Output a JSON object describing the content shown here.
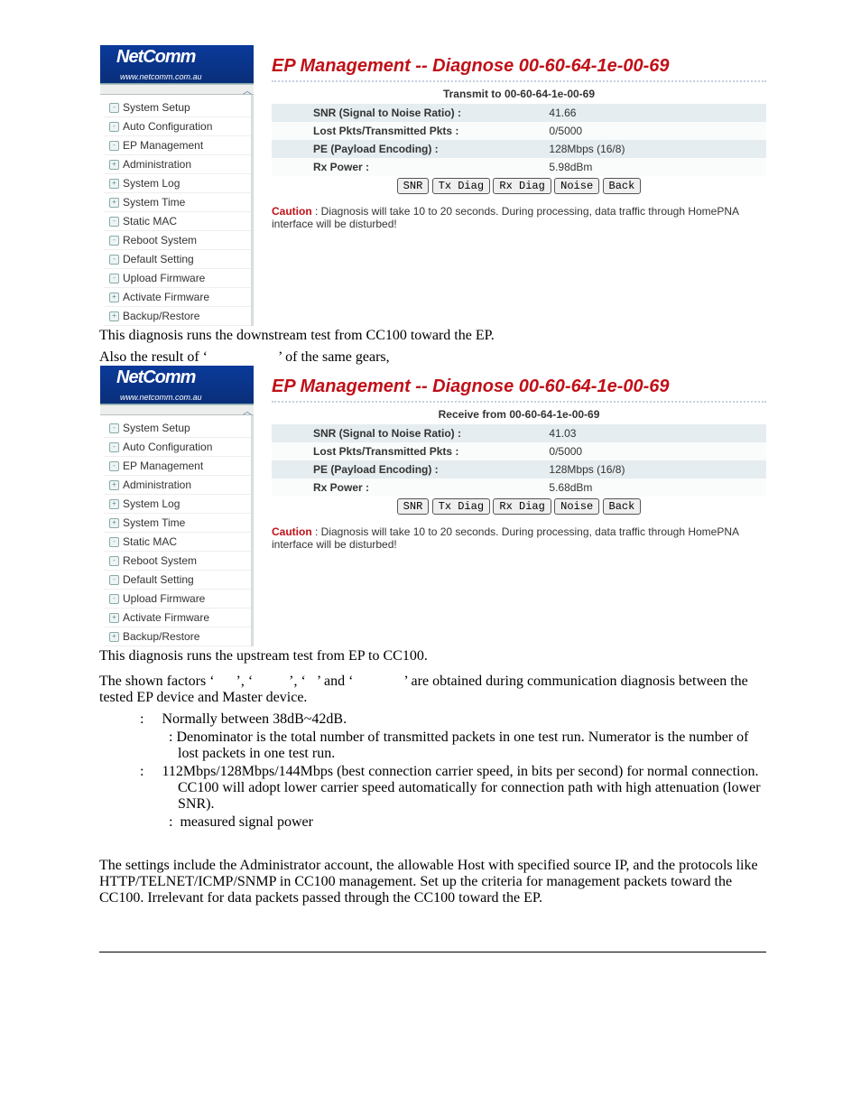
{
  "brand_name": "NetComm",
  "brand_url": "www.netcomm.com.au",
  "sidebar": {
    "items": [
      "System Setup",
      "Auto Configuration",
      "EP Management",
      "Administration",
      "System Log",
      "System Time",
      "Static MAC",
      "Reboot System",
      "Default Setting",
      "Upload Firmware",
      "Activate Firmware",
      "Backup/Restore"
    ]
  },
  "buttons": {
    "snr": "SNR",
    "txdiag": "Tx Diag",
    "rxdiag": "Rx Diag",
    "noise": "Noise",
    "back": "Back"
  },
  "caution_label": "Caution",
  "caution_text": " : Diagnosis will take 10 to 20 seconds. During processing, data traffic through HomePNA interface will be disturbed!",
  "shot1": {
    "title": "EP Management -- Diagnose 00-60-64-1e-00-69",
    "table_title": "Transmit to 00-60-64-1e-00-69",
    "rows": [
      {
        "k": "SNR (Signal to Noise Ratio) :",
        "v": "41.66"
      },
      {
        "k": "Lost Pkts/Transmitted Pkts :",
        "v": "0/5000"
      },
      {
        "k": "PE (Payload Encoding) :",
        "v": "128Mbps (16/8)"
      },
      {
        "k": "Rx Power :",
        "v": "5.98dBm"
      }
    ]
  },
  "shot2": {
    "title": "EP Management -- Diagnose 00-60-64-1e-00-69",
    "table_title": "Receive from 00-60-64-1e-00-69",
    "rows": [
      {
        "k": "SNR (Signal to Noise Ratio) :",
        "v": "41.03"
      },
      {
        "k": "Lost Pkts/Transmitted Pkts :",
        "v": "0/5000"
      },
      {
        "k": "PE (Payload Encoding) :",
        "v": "128Mbps (16/8)"
      },
      {
        "k": "Rx Power :",
        "v": "5.68dBm"
      }
    ]
  },
  "text": {
    "p1": "This diagnosis runs the downstream test from CC100 toward the EP.",
    "p2a": "Also the result of ‘",
    "p2b": "’ of the same gears,",
    "p3": "This diagnosis runs the upstream test from EP to CC100.",
    "p4": "The shown factors ‘      ’, ‘          ’, ‘   ’ and ‘              ’ are obtained during communication diagnosis between the tested EP device and Master device.",
    "def1": ":     Normally between 38dB~42dB.",
    "def2": ": Denominator is the total number of transmitted packets in one test run. Numerator is the number of lost packets in one test run.",
    "def3": ":     112Mbps/128Mbps/144Mbps (best connection carrier speed, in bits per second) for normal connection. CC100 will adopt lower carrier speed automatically for connection path with high attenuation (lower SNR).",
    "def4": ":  measured signal power",
    "admin_para": "The settings include the Administrator account, the allowable Host with specified source IP, and the protocols like HTTP/TELNET/ICMP/SNMP in CC100 management. Set up the criteria for management packets toward the CC100. Irrelevant for data packets passed through the CC100 toward the EP."
  }
}
